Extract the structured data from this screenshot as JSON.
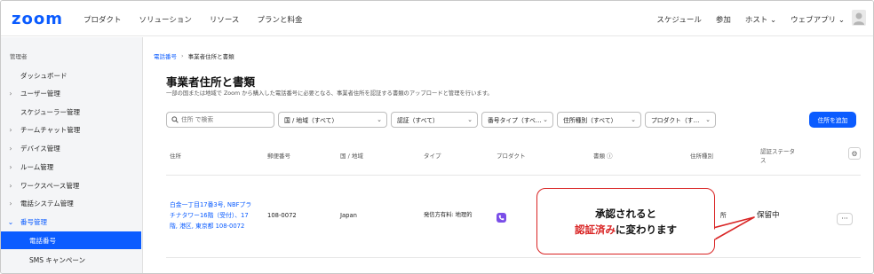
{
  "brand": {
    "logo": "zoom",
    "accent": "#0b5cff",
    "callout_red": "#d92424"
  },
  "topnav": {
    "left": [
      "プロダクト",
      "ソリューション",
      "リソース",
      "プランと料金"
    ],
    "right": [
      "スケジュール",
      "参加",
      "ホスト ⌄",
      "ウェブアプリ ⌄"
    ]
  },
  "sidebar": {
    "header": "管理者",
    "items": [
      {
        "label": "ダッシュボード",
        "expandable": false
      },
      {
        "label": "ユーザー管理",
        "expandable": true
      },
      {
        "label": "スケジューラー管理",
        "expandable": false
      },
      {
        "label": "チームチャット管理",
        "expandable": true
      },
      {
        "label": "デバイス管理",
        "expandable": true
      },
      {
        "label": "ルーム管理",
        "expandable": true
      },
      {
        "label": "ワークスペース管理",
        "expandable": true
      },
      {
        "label": "電話システム管理",
        "expandable": true
      },
      {
        "label": "番号管理",
        "expandable": true,
        "open": true
      },
      {
        "label": "電話番号",
        "active": true
      },
      {
        "label": "SMS キャンペーン"
      }
    ]
  },
  "breadcrumb": {
    "parent": "電話番号",
    "separator": "›",
    "current": "事業者住所と書類"
  },
  "page": {
    "title": "事業者住所と書類",
    "description": "一部の国または地域で Zoom から購入した電話番号に必要となる、事業者住所を認証する書類のアップロードと管理を行います。"
  },
  "filters": {
    "search_placeholder": "住所 で検索",
    "dropdowns": [
      "国 / 地域（すべて）",
      "認証（すべて）",
      "番号タイプ（すべ…",
      "住所種別（すべて）",
      "プロダクト（す…"
    ],
    "add_button": "住所を追加"
  },
  "table": {
    "headers": {
      "address": "住所",
      "postal": "郵便番号",
      "country": "国 / 地域",
      "type": "タイプ",
      "product": "プロダクト",
      "documents": "書類 ⓘ",
      "address_type": "住所種別",
      "status_l1": "認証ステータ",
      "status_l2": "ス"
    },
    "rows": [
      {
        "address_l1": "白金一丁目17番3号, NBFプラ",
        "address_l2": "チナタワー16階（受付）、17",
        "address_l3": "階, 港区, 東京都 108-0072",
        "postal": "108-0072",
        "country": "Japan",
        "type": "発信方有料: 地理的",
        "address_type_partial": "所",
        "status": "保留中",
        "more": "···"
      }
    ]
  },
  "callout": {
    "line1": "承認されると",
    "line2_red": "認証済み",
    "line2_rest": "に変わります"
  },
  "icons": {
    "search": "search-icon",
    "gear": "gear-icon",
    "phone": "phone-icon",
    "avatar": "avatar-icon"
  }
}
